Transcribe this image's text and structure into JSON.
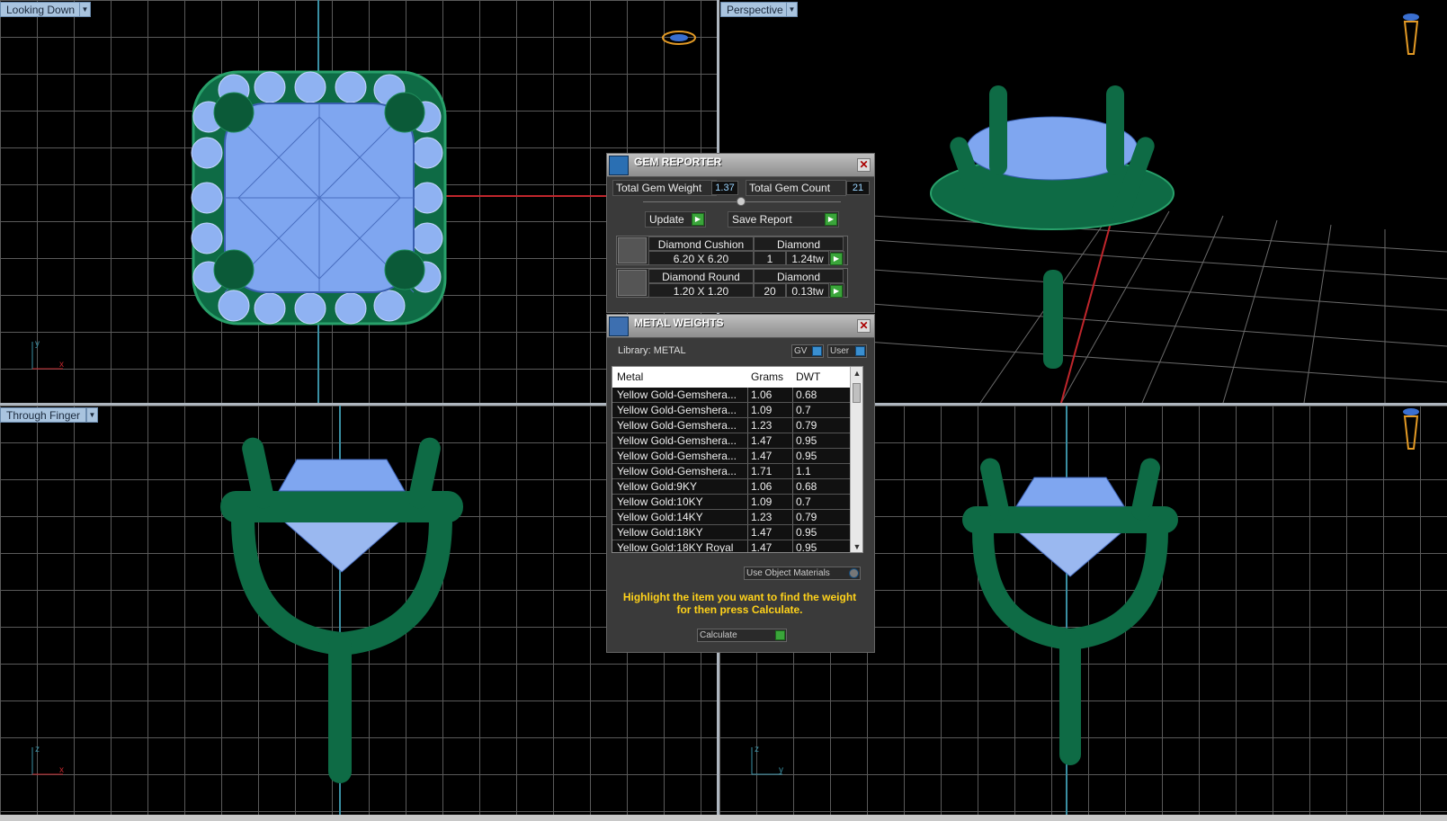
{
  "viewports": {
    "top_left": {
      "label": "Looking Down"
    },
    "top_right": {
      "label": "Perspective"
    },
    "bottom_left": {
      "label": "Through Finger"
    }
  },
  "axes": {
    "top_left": {
      "v": "y",
      "h": "x"
    },
    "bottom_left": {
      "v": "z",
      "h": "x"
    },
    "bottom_right": {
      "v": "z",
      "h": "y"
    }
  },
  "gem_reporter": {
    "title": "GEM REPORTER",
    "total_weight_label": "Total Gem Weight",
    "total_weight": "1.37",
    "total_count_label": "Total Gem Count",
    "total_count": "21",
    "update_label": "Update",
    "save_label": "Save Report",
    "gems": [
      {
        "name": "Diamond Cushion",
        "material": "Diamond",
        "size": "6.20 X 6.20",
        "count": "1",
        "weight": "1.24tw"
      },
      {
        "name": "Diamond Round",
        "material": "Diamond",
        "size": "1.20 X 1.20",
        "count": "20",
        "weight": "0.13tw"
      }
    ]
  },
  "metal_weights": {
    "title": "METAL WEIGHTS",
    "library_label": "Library: METAL",
    "gv_label": "GV",
    "user_label": "User",
    "columns": [
      "Metal",
      "Grams",
      "DWT"
    ],
    "rows": [
      {
        "metal": "Yellow Gold-Gemshera...",
        "grams": "1.06",
        "dwt": "0.68"
      },
      {
        "metal": "Yellow Gold-Gemshera...",
        "grams": "1.09",
        "dwt": "0.7"
      },
      {
        "metal": "Yellow Gold-Gemshera...",
        "grams": "1.23",
        "dwt": "0.79"
      },
      {
        "metal": "Yellow Gold-Gemshera...",
        "grams": "1.47",
        "dwt": "0.95"
      },
      {
        "metal": "Yellow Gold-Gemshera...",
        "grams": "1.47",
        "dwt": "0.95"
      },
      {
        "metal": "Yellow Gold-Gemshera...",
        "grams": "1.71",
        "dwt": "1.1"
      },
      {
        "metal": "Yellow Gold:9KY",
        "grams": "1.06",
        "dwt": "0.68"
      },
      {
        "metal": "Yellow Gold:10KY",
        "grams": "1.09",
        "dwt": "0.7"
      },
      {
        "metal": "Yellow Gold:14KY",
        "grams": "1.23",
        "dwt": "0.79"
      },
      {
        "metal": "Yellow Gold:18KY",
        "grams": "1.47",
        "dwt": "0.95"
      },
      {
        "metal": "Yellow Gold:18KY Royal",
        "grams": "1.47",
        "dwt": "0.95"
      }
    ],
    "use_object_materials": "Use Object Materials",
    "hint": "Highlight the item you want to find the weight for then press Calculate.",
    "calculate_label": "Calculate"
  },
  "colors": {
    "grid": "#5a5a5a",
    "axis_blue": "#3a8fa3",
    "axis_red": "#c0262c",
    "metal_green": "#0e6b45",
    "gem_blue": "#7fa6f0",
    "viewport_label_bg": "#a9c4df",
    "hint_yellow": "#ffd21a"
  }
}
